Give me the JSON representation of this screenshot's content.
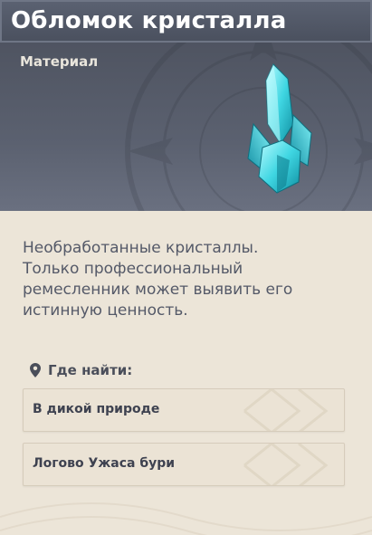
{
  "item": {
    "title": "Обломок кристалла",
    "type": "Материал",
    "icon": "crystal-chunk-icon",
    "description_lines": [
      "Необработанные кристаллы.",
      "Только профессиональный",
      "ремесленник может выявить его",
      "истинную ценность."
    ]
  },
  "where_to_find": {
    "label": "Где найти:",
    "icon": "location-pin-icon",
    "sources": [
      {
        "label": "В дикой природе"
      },
      {
        "label": "Логово Ужаса бури"
      }
    ]
  },
  "colors": {
    "header_bg": "#4f5461",
    "body_bg": "#ece5d8",
    "title_text": "#ffffff",
    "crystal": "#4fd8e0"
  }
}
